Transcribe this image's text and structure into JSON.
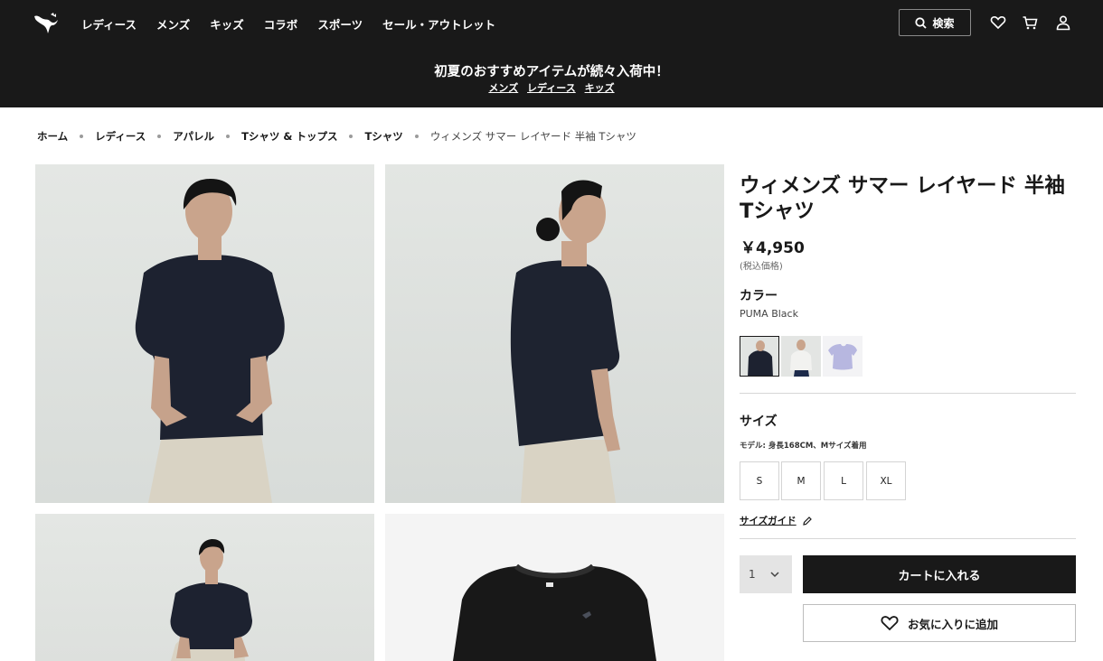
{
  "header": {
    "nav": [
      "レディース",
      "メンズ",
      "キッズ",
      "コラボ",
      "スポーツ",
      "セール・アウトレット"
    ],
    "search_label": "検索",
    "logo_icon": "puma-logo-icon",
    "icons": [
      "search-icon",
      "heart-icon",
      "cart-icon",
      "user-icon"
    ]
  },
  "promo": {
    "title": "初夏のおすすめアイテムが続々入荷中！",
    "links": [
      "メンズ",
      "レディース",
      "キッズ"
    ]
  },
  "breadcrumb": {
    "items": [
      "ホーム",
      "レディース",
      "アパレル",
      "Tシャツ & トップス",
      "Tシャツ"
    ],
    "current": "ウィメンズ サマー レイヤード 半袖 Tシャツ"
  },
  "product": {
    "title": "ウィメンズ サマー レイヤード 半袖 Tシャツ",
    "price": "￥4,950",
    "tax_note": "(税込価格)",
    "color_heading": "カラー",
    "color_value": "PUMA Black",
    "size_heading": "サイズ",
    "size_note": "モデル: 身長168CM、Mサイズ着用",
    "sizes": [
      "S",
      "M",
      "L",
      "XL"
    ],
    "size_guide": "サイズガイド",
    "quantity": "1",
    "add_to_cart": "カートに入れる",
    "wishlist": "お気に入りに追加"
  },
  "colors": {
    "header_bg": "#191919",
    "primary_button": "#191919",
    "quantity_bg": "#e4e4e4"
  }
}
